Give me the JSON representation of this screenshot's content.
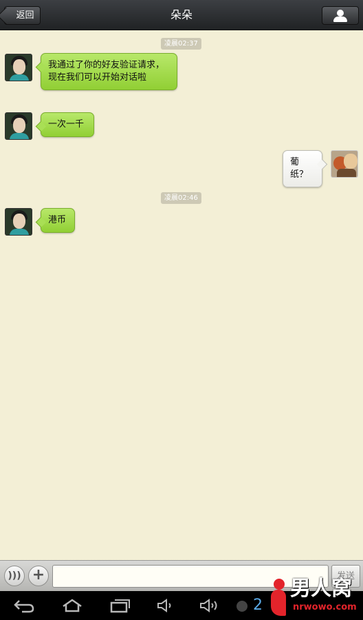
{
  "header": {
    "back_label": "返回",
    "title": "朵朵",
    "profile_icon": "person-icon"
  },
  "messages": [
    {
      "type": "timestamp",
      "text": "凌晨02:37"
    },
    {
      "type": "incoming",
      "text": "我通过了你的好友验证请求，现在我们可以开始对话啦"
    },
    {
      "type": "incoming",
      "text": "一次一千"
    },
    {
      "type": "outgoing",
      "text": "葡纸？"
    },
    {
      "type": "timestamp",
      "text": "凌晨02:46"
    },
    {
      "type": "incoming",
      "text": "港币"
    }
  ],
  "input_bar": {
    "voice_icon": "voice-icon",
    "plus_icon": "plus-icon",
    "input_value": "",
    "send_label": "发送"
  },
  "nav_bar": {
    "icons": [
      "back-icon",
      "home-icon",
      "recent-apps-icon",
      "volume-down-icon",
      "volume-up-icon"
    ],
    "time_fragment": "2"
  },
  "watermark": {
    "text": "男人窝",
    "url": "nrwowo.com"
  },
  "colors": {
    "chat_background": "#f3efd6",
    "incoming_bubble": "#a9df55",
    "outgoing_bubble": "#ffffff",
    "header": "#2c2e30",
    "watermark_red": "#e3242b"
  }
}
